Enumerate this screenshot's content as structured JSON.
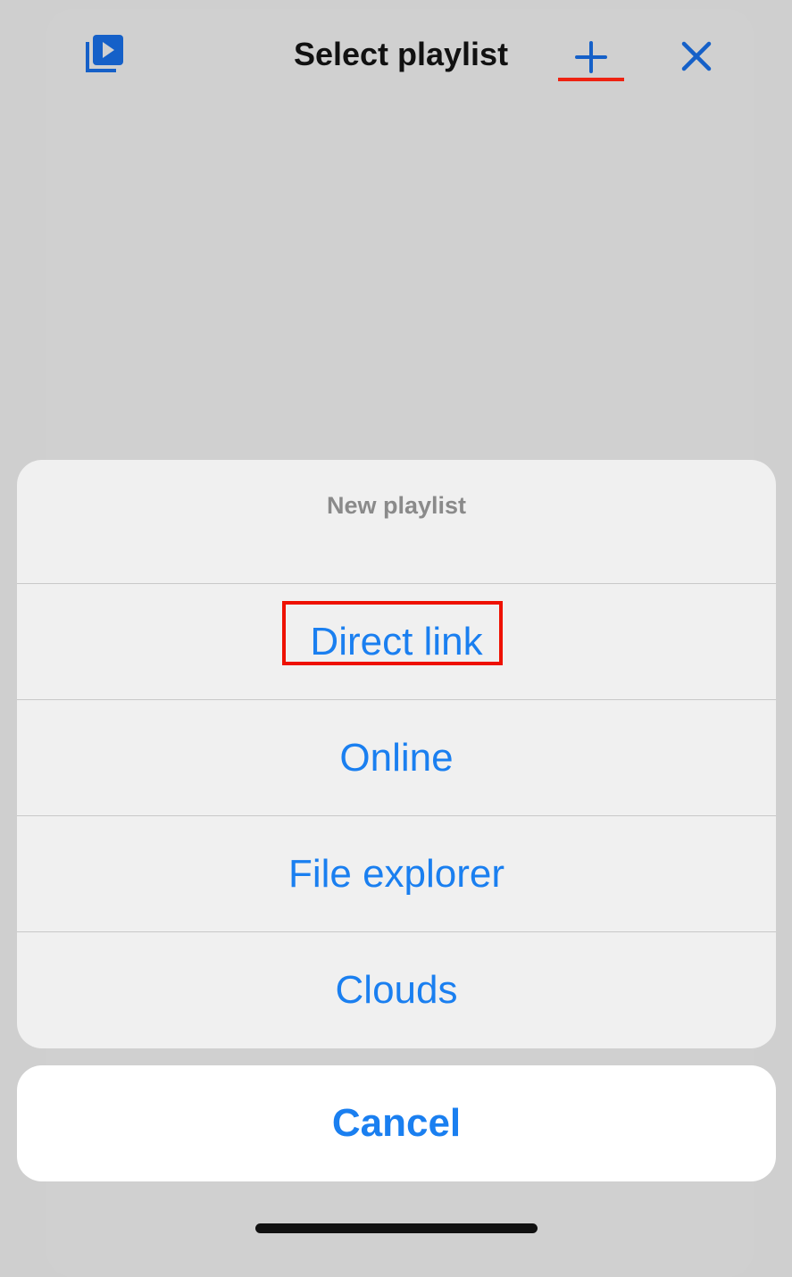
{
  "colors": {
    "accent": "#1a7ff0",
    "header_icon": "#1560c8",
    "highlight": "#ee1100",
    "backdrop": "#cfcfcf"
  },
  "sheet": {
    "title": "Select playlist",
    "left_icon": "playlist-play-icon",
    "add_icon": "plus-icon",
    "close_icon": "close-icon"
  },
  "action_sheet": {
    "header": "New playlist",
    "items": [
      {
        "label": "Direct link",
        "highlighted": true
      },
      {
        "label": "Online"
      },
      {
        "label": "File explorer"
      },
      {
        "label": "Clouds"
      }
    ],
    "cancel_label": "Cancel"
  }
}
